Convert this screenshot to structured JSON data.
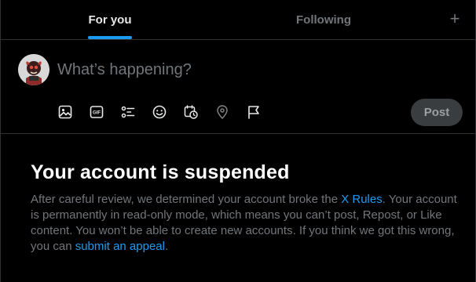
{
  "tabs": {
    "for_you": "For you",
    "following": "Following",
    "add": "+"
  },
  "composer": {
    "placeholder": "What’s happening?",
    "post_label": "Post",
    "tools": [
      {
        "icon": "image-icon"
      },
      {
        "icon": "gif-icon",
        "label": "GIF"
      },
      {
        "icon": "poll-icon"
      },
      {
        "icon": "emoji-icon"
      },
      {
        "icon": "schedule-icon"
      },
      {
        "icon": "location-icon"
      },
      {
        "icon": "flag-icon"
      }
    ]
  },
  "notice": {
    "title": "Your account is suspended",
    "body_part1": "After careful review, we determined your account broke the ",
    "rules_link": "X Rules",
    "body_part2": ". Your account is permanently in read-only mode, which means you can’t post, Repost, or Like content. You won’t be able to create new accounts. If you think we got this wrong, you can ",
    "appeal_link": "submit an appeal",
    "body_end": "."
  },
  "colors": {
    "background": "#000000",
    "accent": "#1d9bf0",
    "muted": "#71767b",
    "border": "#2f3336"
  }
}
